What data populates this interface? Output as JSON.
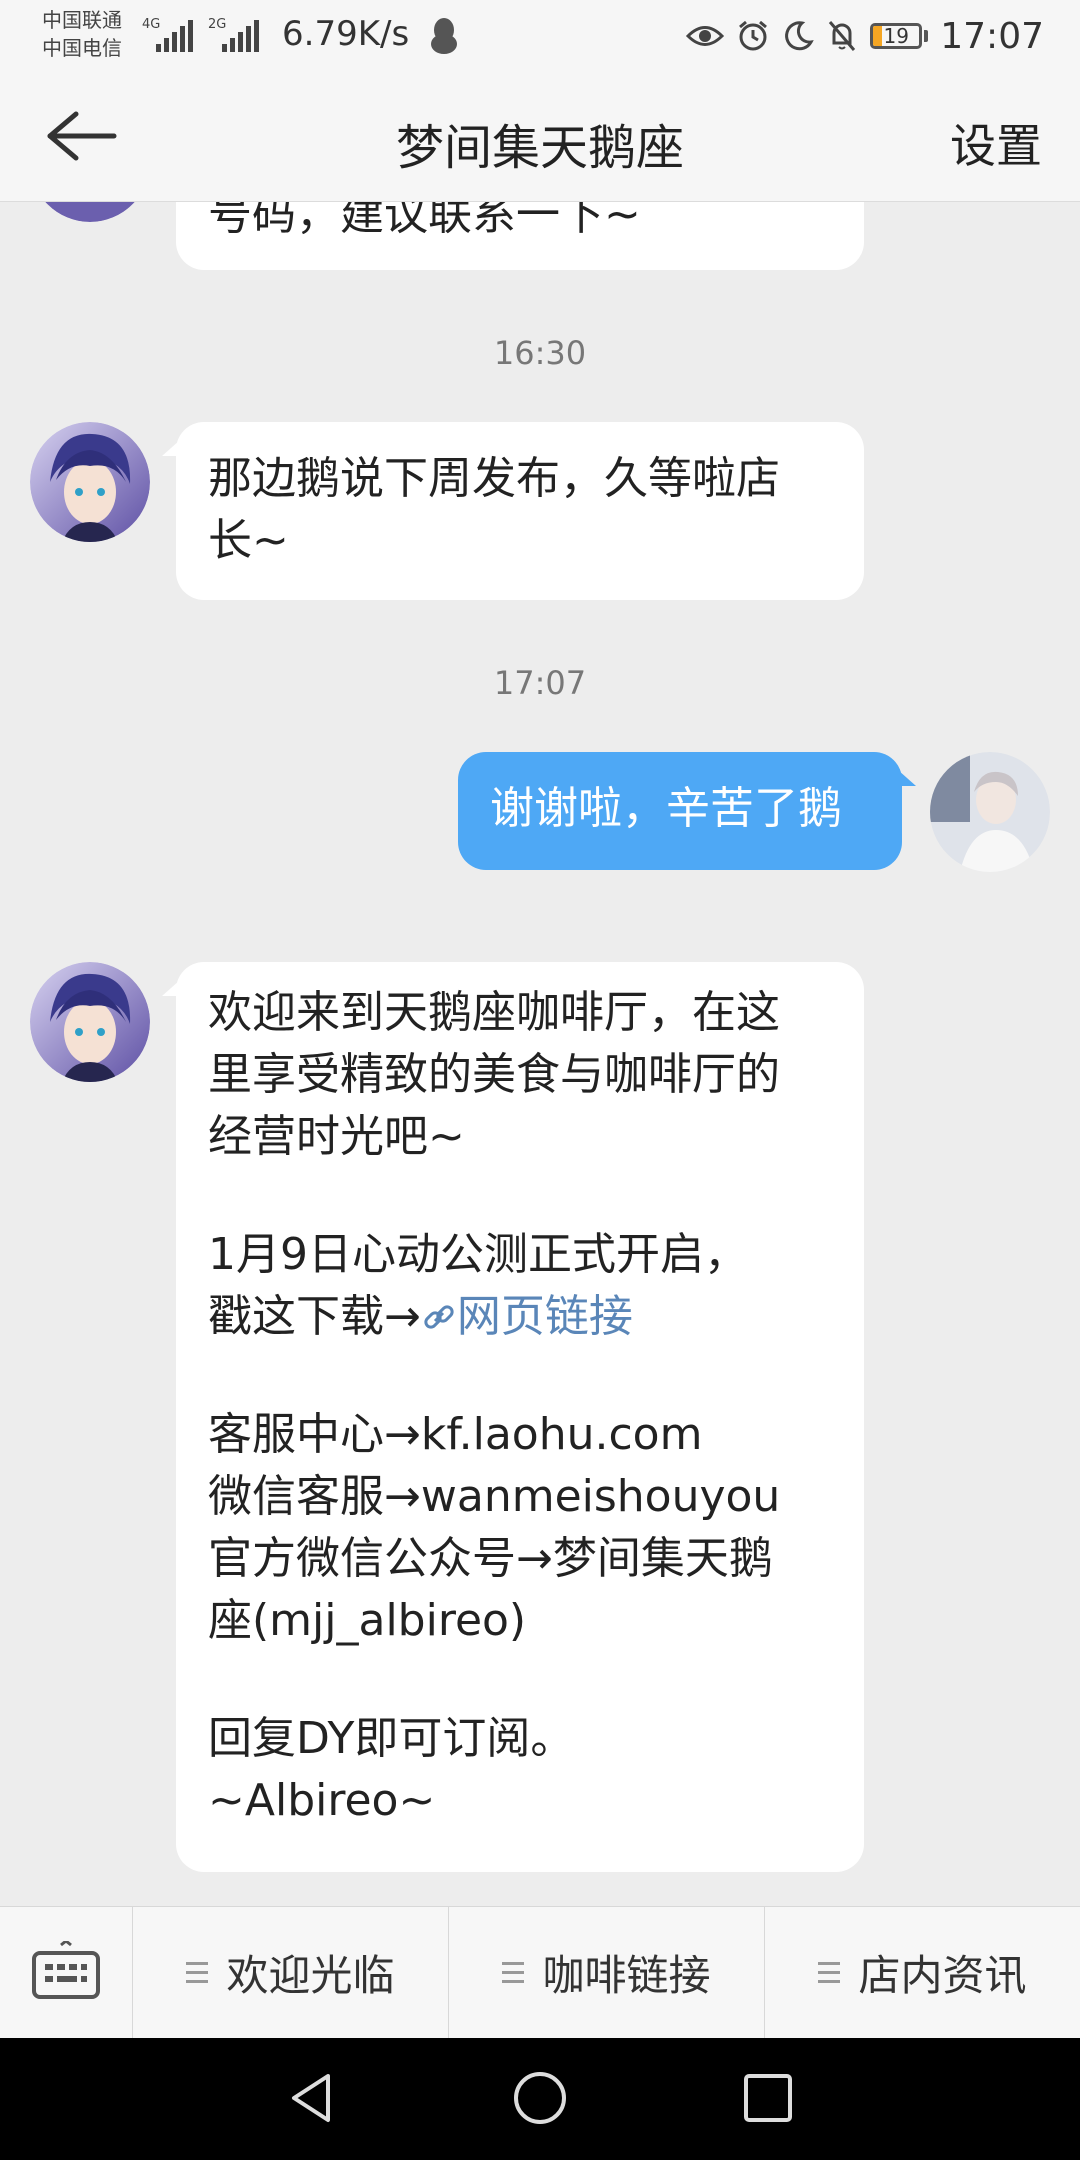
{
  "status_bar": {
    "carrier_1": "中国联通",
    "carrier_2": "中国电信",
    "net_1": "4G",
    "net_2": "2G",
    "net_speed": "6.79K/s",
    "battery_level": "19",
    "time": "17:07"
  },
  "header": {
    "title": "梦间集天鹅座",
    "settings_label": "设置"
  },
  "messages": {
    "m0": {
      "text": "号码，建议联系一下~"
    },
    "t1": "16:30",
    "m1": {
      "line1": "那边鹅说下周发布，久等啦店",
      "line2": "长~"
    },
    "t2": "17:07",
    "m2": {
      "text": "谢谢啦，辛苦了鹅"
    },
    "m3": {
      "l1": "欢迎来到天鹅座咖啡厅，在这",
      "l2": "里享受精致的美食与咖啡厅的",
      "l3": "经营时光吧~",
      "l4": "1月9日心动公测正式开启，",
      "l5_prefix": "戳这下载→",
      "l5_link": "网页链接",
      "l6": "客服中心→kf.laohu.com",
      "l7": "微信客服→wanmeishouyou",
      "l8": "官方微信公众号→梦间集天鹅",
      "l9": "座(mjj_albireo)",
      "l10": "回复DY即可订阅。",
      "l11": "~Albireo~"
    }
  },
  "menu": {
    "items": [
      {
        "label": "欢迎光临"
      },
      {
        "label": "咖啡链接"
      },
      {
        "label": "店内资讯"
      }
    ]
  },
  "colors": {
    "outgoing_bubble": "#4ea8f5",
    "link": "#5a86b8"
  },
  "icons": [
    "eye-icon",
    "alarm-icon",
    "moon-icon",
    "mute-bell-icon",
    "back-arrow-icon",
    "keyboard-icon",
    "menu-lines-icon",
    "nav-back-icon",
    "nav-home-icon",
    "nav-recents-icon",
    "qq-penguin-icon"
  ]
}
